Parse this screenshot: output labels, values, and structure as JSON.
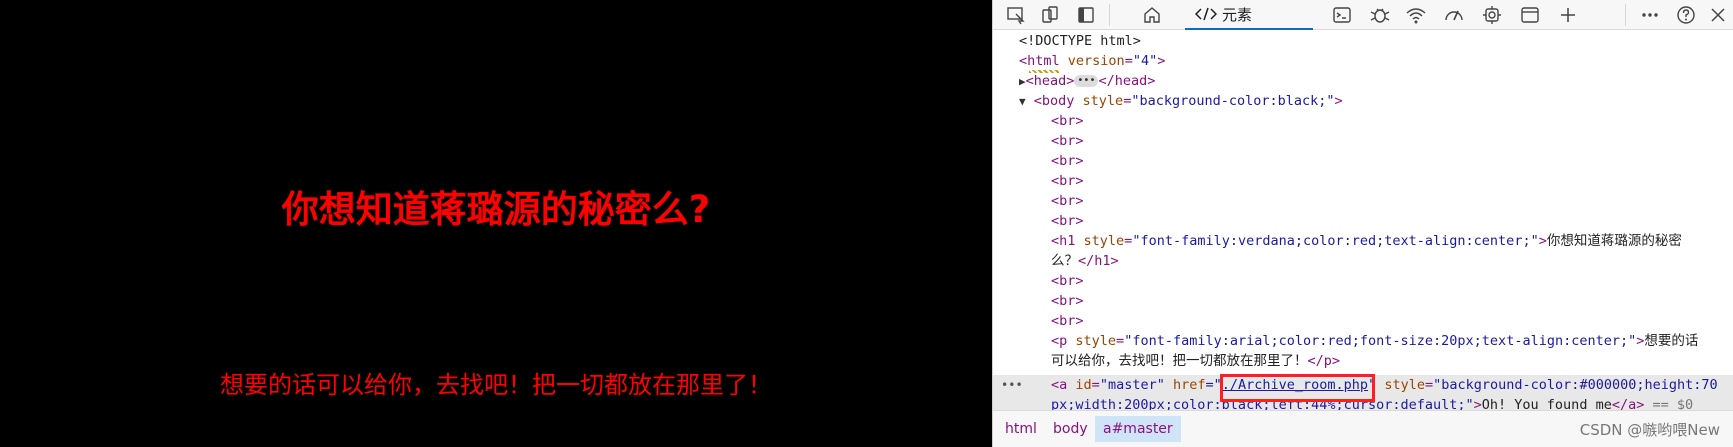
{
  "page": {
    "heading": "你想知道蒋璐源的秘密么?",
    "paragraph": "想要的话可以给你，去找吧！把一切都放在那里了！",
    "background": "#000000",
    "text_color": "#ff0000"
  },
  "devtools": {
    "toolbar": {
      "icons": [
        "inspect-icon",
        "device-emulation-icon",
        "dock-icon",
        "home-icon",
        "elements-tab-icon",
        "console-icon",
        "sources-bug-icon",
        "network-icon",
        "performance-icon",
        "settings-gear-icon",
        "application-icon",
        "add-tab-icon",
        "more-icon",
        "help-icon",
        "close-icon"
      ],
      "elements_tab_label": "元素"
    },
    "dom": {
      "doctype": "<!DOCTYPE html>",
      "html_open": "<html",
      "html_attr_name": "version",
      "html_attr_val": "\"4\"",
      "html_close": ">",
      "head_open": "<head>",
      "head_close": "</head>",
      "body_open": "<body",
      "body_attr_name": "style",
      "body_attr_val": "\"background-color:black;\"",
      "body_close": ">",
      "br": "<br>",
      "h1_open": "<h1",
      "h1_attr_name": "style",
      "h1_attr_val": "\"font-family:verdana;color:red;text-align:center;\"",
      "h1_gt": ">",
      "h1_text_1": "你想知道蒋璐源的秘密",
      "h1_text_2": "么？",
      "h1_close": "</h1>",
      "p_open": "<p",
      "p_attr_name": "style",
      "p_attr_val": "\"font-family:arial;color:red;font-size:20px;text-align:center;\"",
      "p_gt": ">",
      "p_text_1": "想要的话",
      "p_text_2": "可以给你，去找吧！把一切都放在那里了！",
      "p_close": "</p>",
      "a_open": "<a",
      "a_id_name": "id",
      "a_id_val": "\"master\"",
      "a_href_name": "href",
      "a_href_q1": "=\"",
      "a_href_val": "./Archive_room.php",
      "a_href_q2": "\"",
      "a_style_name": "style",
      "a_style_val_1": "\"background-color:#000000;height:70",
      "a_style_val_2": "px;width:200px;color:black;left:44%;cursor:default;\"",
      "a_gt": ">",
      "a_text": "Oh! You found me",
      "a_close": "</a>",
      "a_eq": "== $0",
      "row_menu": "•••"
    },
    "breadcrumbs": [
      "html",
      "body",
      "a#master"
    ],
    "watermark": "CSDN @嗾哟喂New"
  }
}
